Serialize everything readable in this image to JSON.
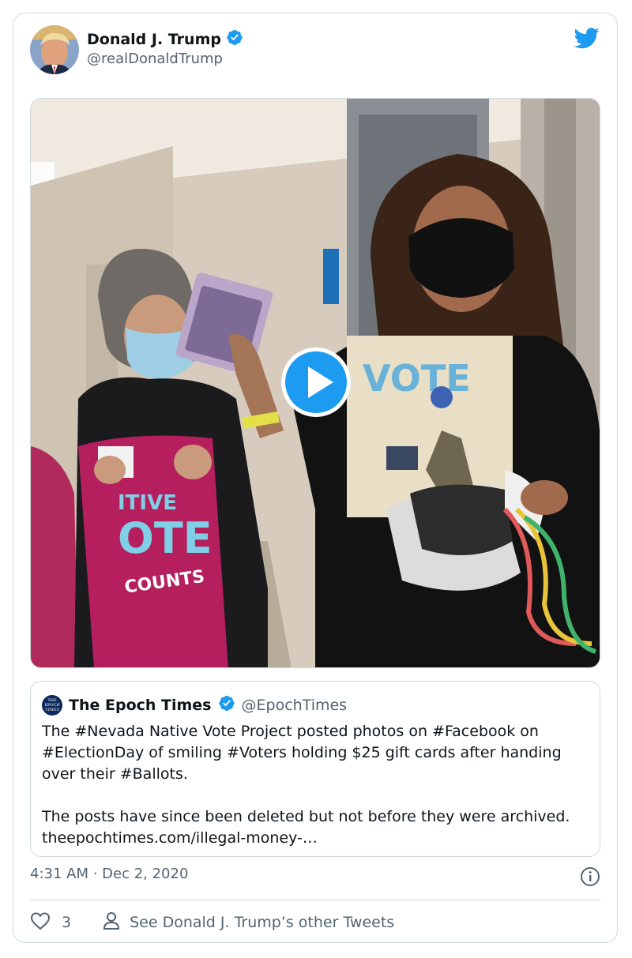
{
  "colors": {
    "accent": "#1d9bf0",
    "text_primary": "#0f1419",
    "text_secondary": "#536471",
    "border": "#cfd9de"
  },
  "author": {
    "name": "Donald J. Trump",
    "handle": "@realDonaldTrump",
    "verified": true
  },
  "media": {
    "type": "video",
    "icon": "play-icon",
    "shirt_text": [
      "ITIVE",
      "OTE",
      "COUNTS"
    ],
    "tshirt_text": "VOTE"
  },
  "quoted_tweet": {
    "logo_text": "THE EPOCH TIMES",
    "name": "The Epoch Times",
    "handle": "@EpochTimes",
    "verified": true,
    "paragraph1": "The #Nevada Native Vote Project posted photos on #Facebook on #ElectionDay of smiling #Voters holding $25 gift cards after handing over their #Ballots.",
    "paragraph2": "The posts have since been deleted but not before they were archived. theepochtimes.com/illegal-money-…"
  },
  "timestamp": "4:31 AM · Dec 2, 2020",
  "actions": {
    "like_count": "3",
    "other_tweets": "See Donald J. Trump’s other Tweets"
  }
}
